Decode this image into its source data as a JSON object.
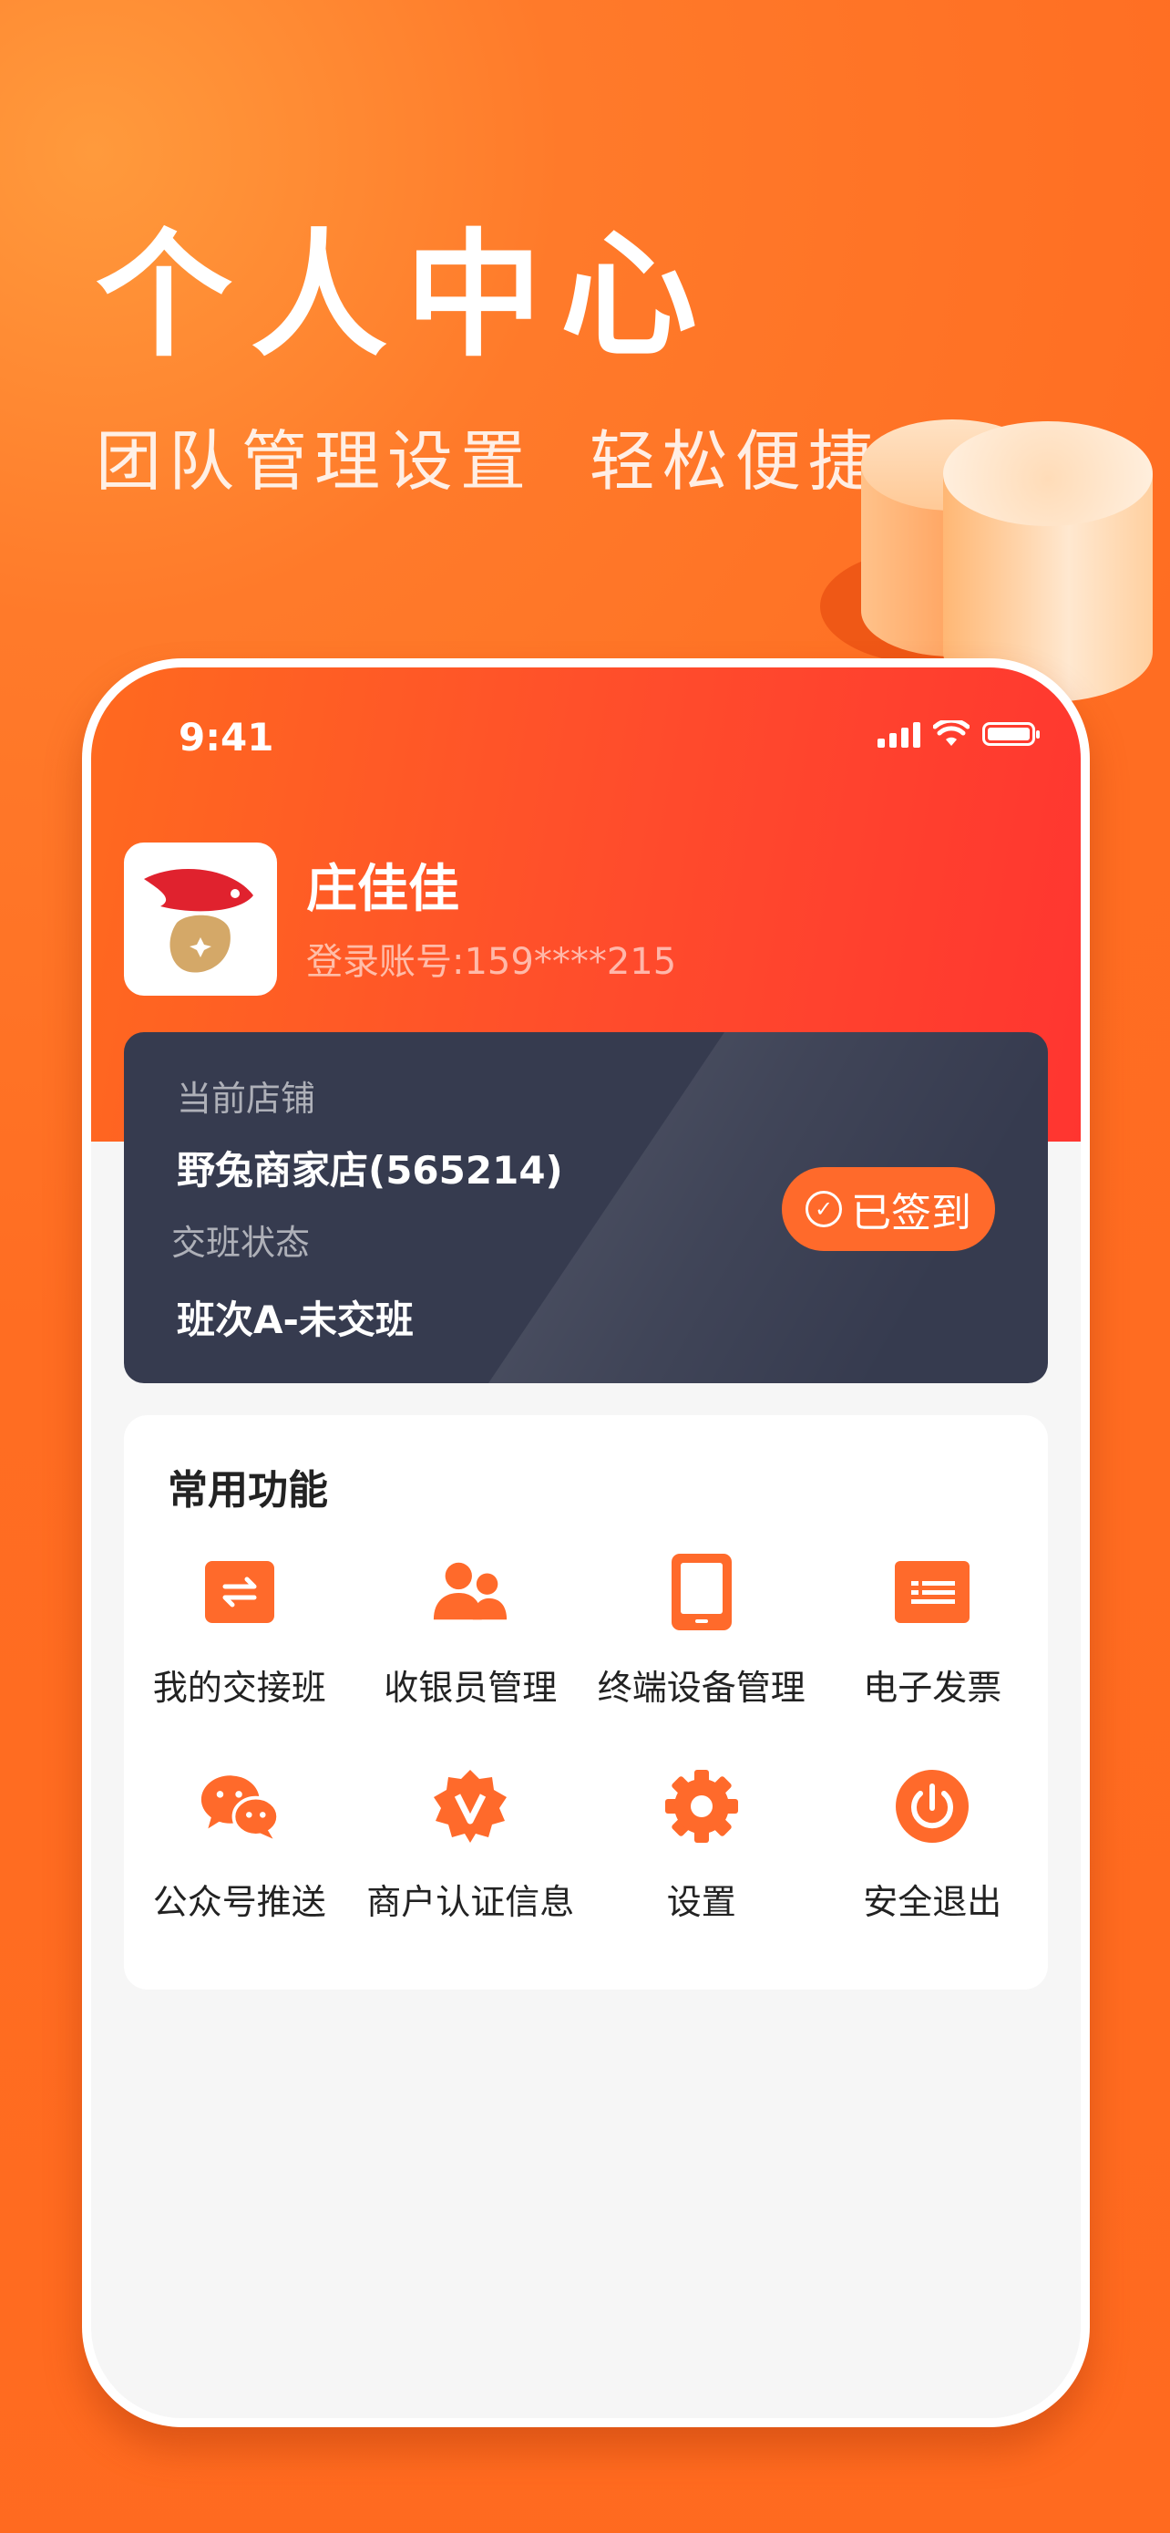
{
  "promo": {
    "title": "个人中心",
    "subtitle": "团队管理设置  轻松便捷"
  },
  "status_bar": {
    "time": "9:41"
  },
  "user": {
    "name": "庄佳佳",
    "account": "登录账号:159****215"
  },
  "store": {
    "store_label": "当前店铺",
    "store_name": "野兔商家店(565214)",
    "shift_label": "交班状态",
    "shift_status": "班次A-未交班",
    "signed_button": "已签到"
  },
  "functions": {
    "title": "常用功能",
    "items": [
      {
        "label": "我的交接班",
        "icon": "shift-exchange-icon"
      },
      {
        "label": "收银员管理",
        "icon": "cashier-users-icon"
      },
      {
        "label": "终端设备管理",
        "icon": "tablet-device-icon"
      },
      {
        "label": "电子发票",
        "icon": "invoice-icon"
      },
      {
        "label": "公众号推送",
        "icon": "wechat-icon"
      },
      {
        "label": "商户认证信息",
        "icon": "verified-badge-icon"
      },
      {
        "label": "设置",
        "icon": "gear-icon"
      },
      {
        "label": "安全退出",
        "icon": "power-icon"
      }
    ]
  },
  "colors": {
    "accent": "#ff6a2b",
    "card_dark": "#363b4f",
    "header_red": "#ff3530"
  }
}
